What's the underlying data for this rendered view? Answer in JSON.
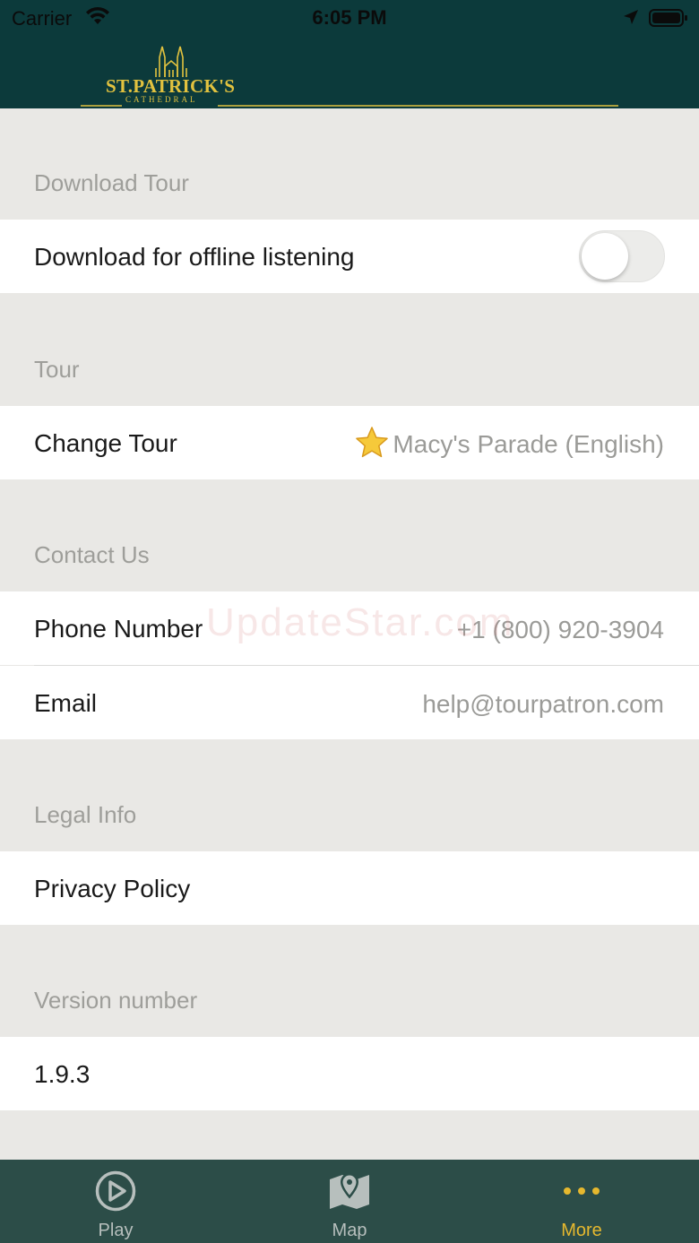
{
  "status_bar": {
    "carrier": "Carrier",
    "time": "6:05 PM",
    "icons": [
      "wifi-icon",
      "location-arrow-icon",
      "battery-icon"
    ]
  },
  "header": {
    "logo_text": "ST.PATRICK'S",
    "logo_subtext": "CATHEDRAL",
    "background_color": "#0c3a3b",
    "accent_color": "#e2c23f"
  },
  "sections": {
    "download": {
      "header": "Download Tour",
      "offline_label": "Download for offline listening",
      "offline_enabled": false
    },
    "tour": {
      "header": "Tour",
      "change_label": "Change Tour",
      "current_tour": "Macy's Parade (English)",
      "current_tour_icon": "star-icon"
    },
    "contact": {
      "header": "Contact Us",
      "phone_label": "Phone Number",
      "phone_value": "+1 (800) 920-3904",
      "email_label": "Email",
      "email_value": "help@tourpatron.com"
    },
    "legal": {
      "header": "Legal Info",
      "privacy_label": "Privacy Policy"
    },
    "version": {
      "header": "Version number",
      "value": "1.9.3"
    }
  },
  "watermark": "UpdateStar.com",
  "tab_bar": {
    "background_color": "#2c4d48",
    "active_color": "#e6b82e",
    "tabs": [
      {
        "label": "Play",
        "icon": "play-circle-icon",
        "active": false
      },
      {
        "label": "Map",
        "icon": "map-pin-icon",
        "active": false
      },
      {
        "label": "More",
        "icon": "more-dots-icon",
        "active": true
      }
    ]
  }
}
